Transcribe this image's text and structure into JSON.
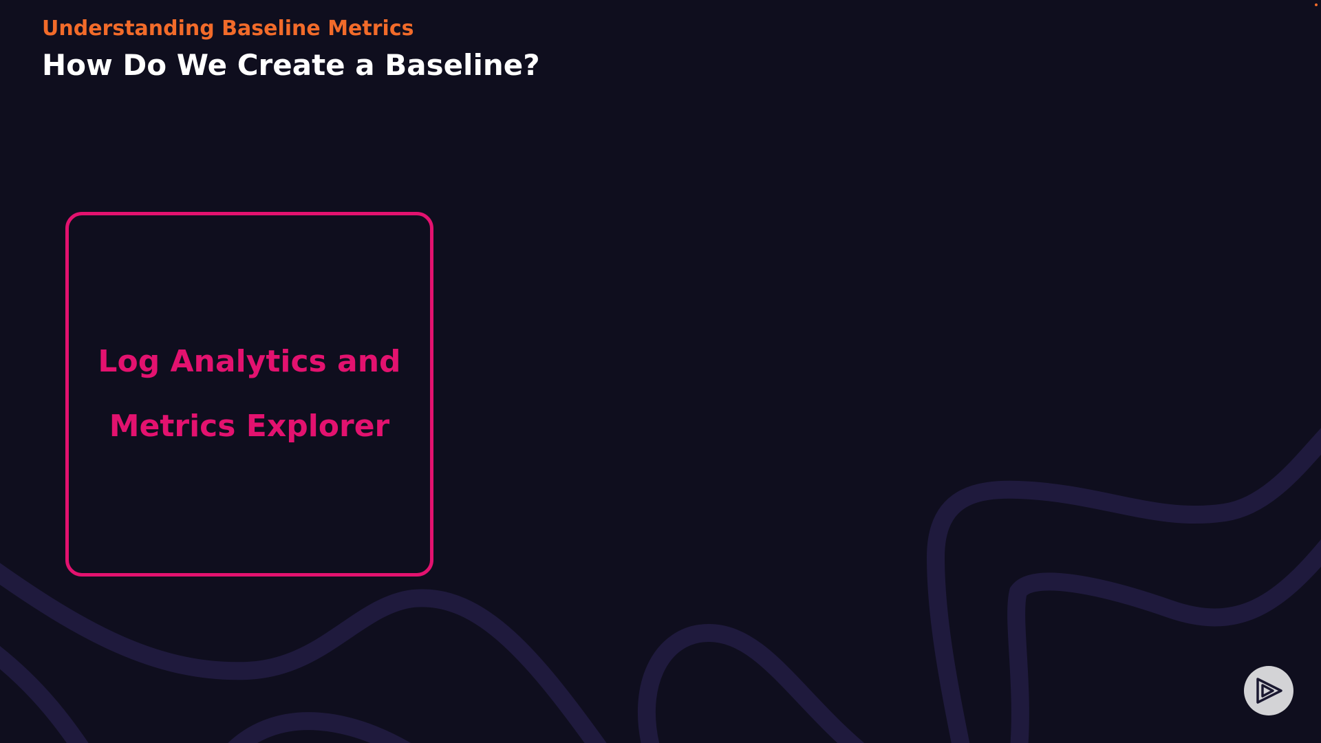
{
  "header": {
    "section_title": "Understanding Baseline Metrics",
    "title": "How Do We Create a Baseline?"
  },
  "card": {
    "line1": "Log Analytics and",
    "line2": "Metrics Explorer"
  },
  "colors": {
    "background": "#0f0e1e",
    "accent_orange": "#f26b2a",
    "accent_pink": "#e3126f",
    "wave": "#1f1a3d",
    "badge": "#d3d3d6"
  },
  "icons": {
    "player_logo": "play-logo-icon"
  }
}
